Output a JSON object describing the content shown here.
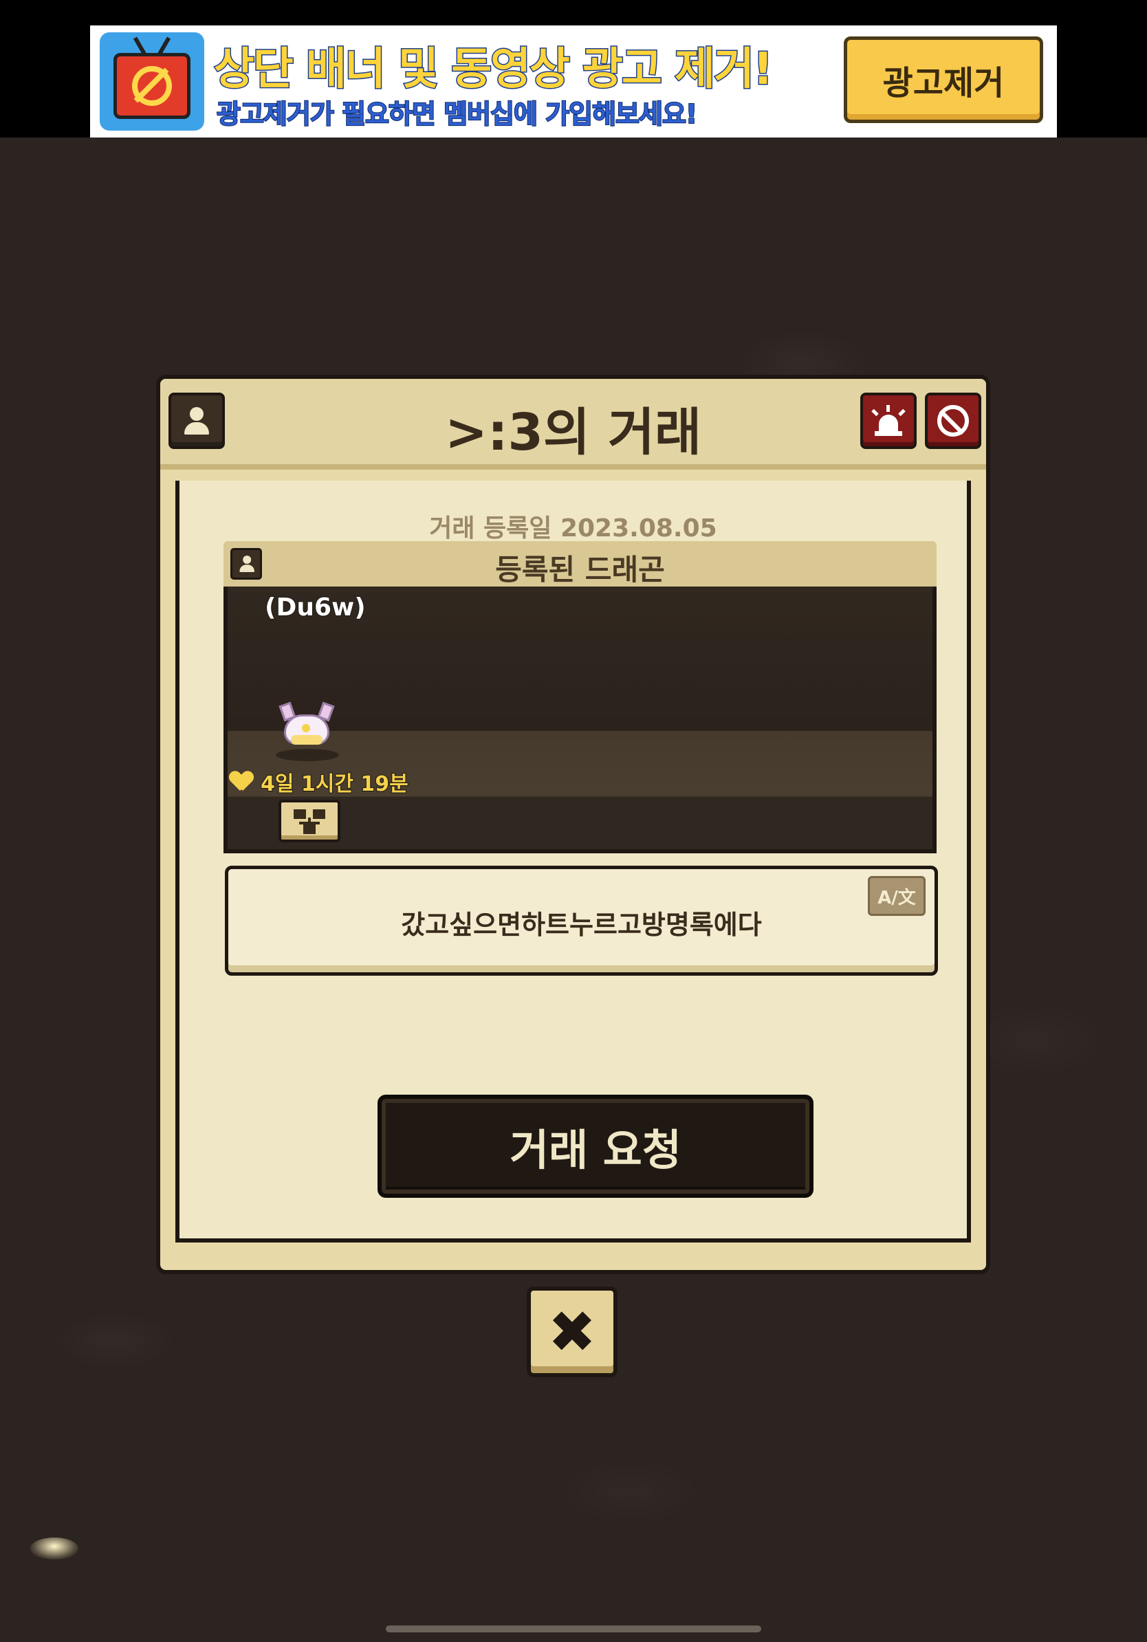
{
  "ad_banner": {
    "title": "상단 배너 및 동영상 광고 제거!",
    "subtitle": "광고제거가 필요하면 멤버십에 가입해보세요!",
    "button_label": "광고제거",
    "icon": "no-ads-tv-icon"
  },
  "dialog": {
    "title": ">:3의 거래",
    "header_icons": [
      "profile-icon",
      "report-siren-icon",
      "block-icon"
    ],
    "registration_date": "거래 등록일 2023.08.05",
    "section_title": "등록된 드래곤",
    "dragon": {
      "name": "(Du6w)",
      "timer": "4일 1시간 19분"
    },
    "message": "갔고싶으면하트누르고방명록에다",
    "translate_label": "A/文",
    "trade_request_label": "거래 요청"
  },
  "close_label": "✖",
  "colors": {
    "background": "#2c2420",
    "dialog_paper": "#f0e7c6",
    "accent_red": "#8a1c1c",
    "timer_yellow": "#f6d24a"
  }
}
